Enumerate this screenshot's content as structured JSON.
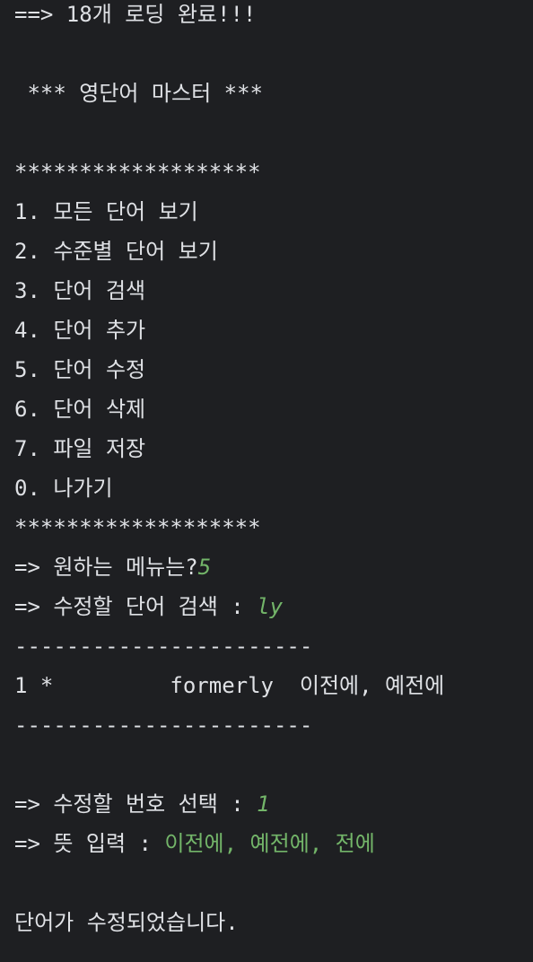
{
  "console": {
    "loaded": "==> 18개 로딩 완료!!!",
    "title": " *** 영단어 마스터 ***",
    "star_line_top": "*******************",
    "menu": [
      "1. 모든 단어 보기",
      "2. 수준별 단어 보기",
      "3. 단어 검색",
      "4. 단어 추가",
      "5. 단어 수정",
      "6. 단어 삭제",
      "7. 파일 저장",
      "0. 나가기"
    ],
    "star_line_bottom": "*******************",
    "menu_prompt": "=> 원하는 메뉴는?",
    "menu_input": "5",
    "search_prompt": "=> 수정할 단어 검색 : ",
    "search_input": "ly",
    "dash_line_top": "-----------------------",
    "result_row": "1 *         formerly  이전에, 예전에",
    "dash_line_bottom": "-----------------------",
    "select_prompt": "=> 수정할 번호 선택 : ",
    "select_input": "1",
    "meaning_prompt": "=> 뜻 입력 : ",
    "meaning_input": "이전에, 예전에, 전에",
    "done": "단어가 수정되었습니다."
  }
}
